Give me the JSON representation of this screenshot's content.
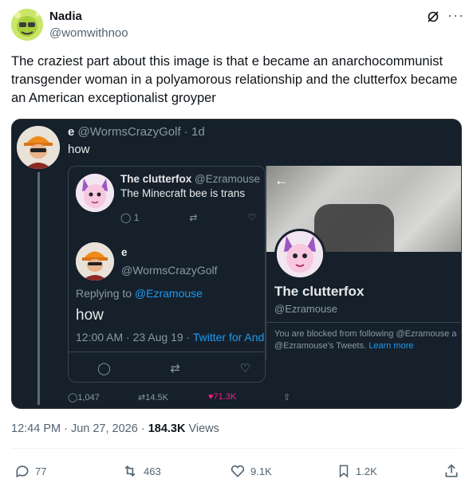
{
  "author": {
    "name": "Nadia",
    "handle": "@womwithnoo"
  },
  "tweet": {
    "text": "The craziest part about this image is that e became an anarchocommunist transgender woman in a polyamorous relationship and the clutterfox became an American exceptionalist groyper"
  },
  "embed": {
    "outer": {
      "name": "e",
      "handle_time": "@WormsCrazyGolf · 1d",
      "text": "how",
      "stats": {
        "replies": "1,047",
        "retweets": "14.5K",
        "likes": "71.3K"
      }
    },
    "quoted": {
      "name": "The clutterfox",
      "handle": "@Ezramouse",
      "text": "The Minecraft bee is trans",
      "replies": "1",
      "reply_author": "e",
      "reply_handle": "@WormsCrazyGolf",
      "replying_to_label": "Replying to ",
      "replying_to_handle": "@Ezramouse",
      "reply_text": "how",
      "reply_time": "12:00 AM · 23 Aug 19 · ",
      "reply_source": "Twitter for And"
    },
    "profile": {
      "name": "The clutterfox",
      "handle": "@Ezramouse",
      "blocked_line1": "You are blocked from following @Ezramouse a",
      "blocked_line2_prefix": "@Ezramouse's Tweets. ",
      "learn_more": "Learn more"
    }
  },
  "meta": {
    "time": "12:44 PM · Jun 27, 2026 · ",
    "views_count": "184.3K",
    "views_label": " Views"
  },
  "actions": {
    "replies": "77",
    "retweets": "463",
    "likes": "9.1K",
    "bookmarks": "1.2K"
  },
  "colors": {
    "accent": "#1d9bf0",
    "like": "#f91880",
    "dark_bg": "#15202b"
  }
}
